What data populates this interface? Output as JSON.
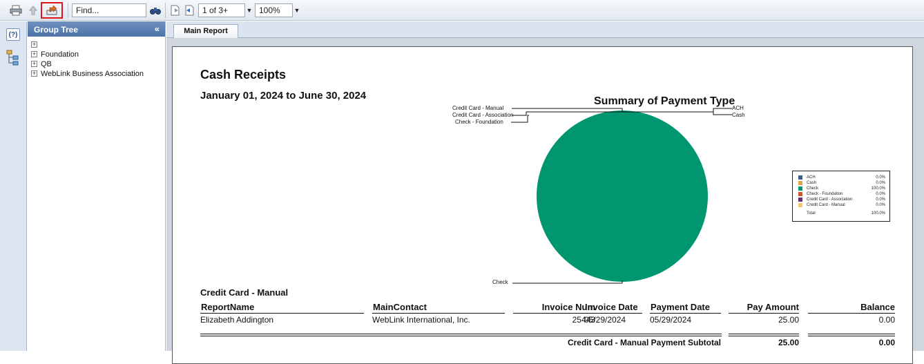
{
  "toolbar": {
    "find_placeholder": "Find...",
    "page_nav": "1 of 3+",
    "zoom": "100%"
  },
  "group_tree": {
    "title": "Group Tree",
    "items": [
      {
        "label": ""
      },
      {
        "label": "Foundation"
      },
      {
        "label": "QB"
      },
      {
        "label": "WebLink Business Association"
      }
    ]
  },
  "tabs": [
    {
      "label": "Main Report"
    }
  ],
  "report": {
    "title": "Cash Receipts",
    "date_range": "January 01, 2024 to June 30, 2024"
  },
  "chart_data": {
    "type": "pie",
    "title": "Summary of Payment Type",
    "legend_placement": "right",
    "slices": [
      {
        "name": "ACH",
        "value": 0.0,
        "label": "0.0%",
        "color": "#3a5e8c"
      },
      {
        "name": "Cash",
        "value": 0.0,
        "label": "0.0%",
        "color": "#e6a04a"
      },
      {
        "name": "Check",
        "value": 100.0,
        "label": "100.0%",
        "color": "#009670"
      },
      {
        "name": "Check - Foundation",
        "value": 0.0,
        "label": "0.0%",
        "color": "#d4542a"
      },
      {
        "name": "Credit Card - Association",
        "value": 0.0,
        "label": "0.0%",
        "color": "#6a2f6f"
      },
      {
        "name": "Credit Card - Manual",
        "value": 0.0,
        "label": "0.0%",
        "color": "#f2c66b"
      }
    ],
    "total_label": "Total",
    "total_value": "100.0%"
  },
  "table": {
    "group_name": "Credit Card - Manual",
    "columns": [
      "ReportName",
      "MainContact",
      "Invoice Num",
      "Invoice Date",
      "Payment Date",
      "Pay Amount",
      "Balance"
    ],
    "rows": [
      [
        "Elizabeth Addington",
        "WebLink International, Inc.",
        "25443",
        "05/29/2024",
        "05/29/2024",
        "25.00",
        "0.00"
      ]
    ],
    "subtotal_label": "Credit Card - Manual Payment Subtotal",
    "subtotal_amount": "25.00",
    "subtotal_balance": "0.00"
  }
}
